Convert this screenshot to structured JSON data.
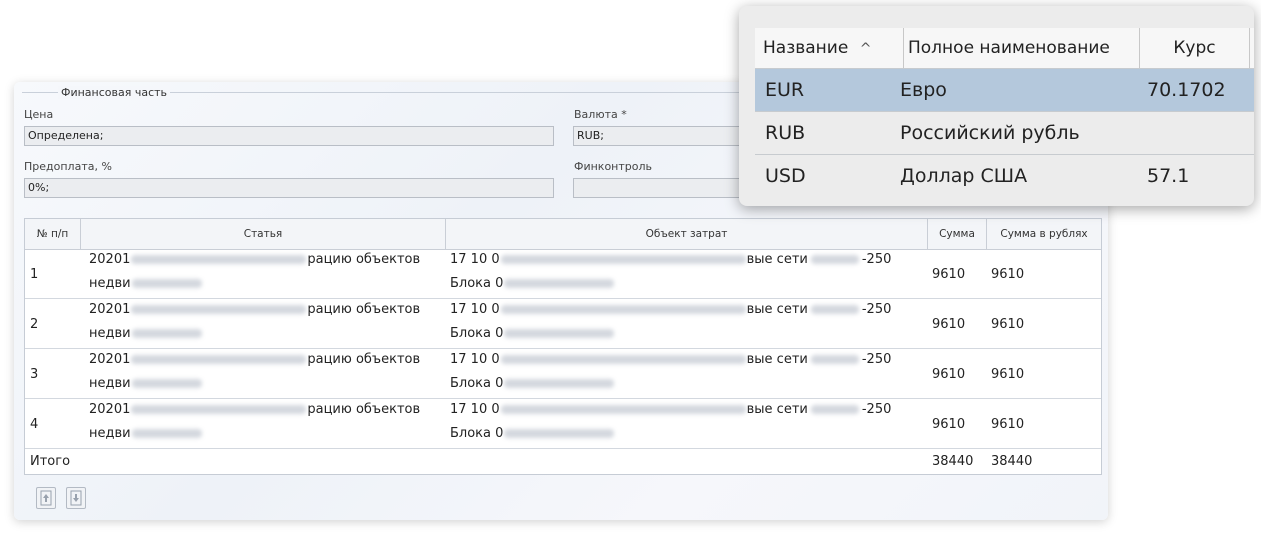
{
  "finance": {
    "section_title": "Финансовая часть",
    "price_label": "Цена",
    "price_value": "Определена;",
    "currency_label": "Валюта *",
    "currency_value": "RUB;",
    "prepay_label": "Предоплата, %",
    "prepay_value": "0%;",
    "fincontrol_label": "Финконтроль",
    "fincontrol_value": ""
  },
  "table": {
    "columns": [
      "№ п/п",
      "Статья",
      "Объект затрат",
      "Сумма",
      "Сумма в рублях"
    ],
    "rows": [
      {
        "num": "1",
        "article_a": "20201",
        "article_b": "рацию объектов",
        "article_c": "недви",
        "object_a": "17 10 0",
        "object_b": "вые сети",
        "object_c": "-250",
        "object_d": "Блока 0",
        "sum": "9610",
        "sum_rub": "9610"
      },
      {
        "num": "2",
        "article_a": "20201",
        "article_b": "рацию объектов",
        "article_c": "недви",
        "object_a": "17 10 0",
        "object_b": "вые сети",
        "object_c": "-250",
        "object_d": "Блока 0",
        "sum": "9610",
        "sum_rub": "9610"
      },
      {
        "num": "3",
        "article_a": "20201",
        "article_b": "рацию объектов",
        "article_c": "недви",
        "object_a": "17 10 0",
        "object_b": "вые сети",
        "object_c": "-250",
        "object_d": "Блока 0",
        "sum": "9610",
        "sum_rub": "9610"
      },
      {
        "num": "4",
        "article_a": "20201",
        "article_b": "рацию объектов",
        "article_c": "недви",
        "object_a": "17 10 0",
        "object_b": "вые сети",
        "object_c": "-250",
        "object_d": "Блока 0",
        "sum": "9610",
        "sum_rub": "9610"
      }
    ],
    "total_label": "Итого",
    "total_sum": "38440",
    "total_sum_rub": "38440"
  },
  "toolbar": {
    "up_icon": "arrow-up-icon",
    "down_icon": "arrow-down-icon"
  },
  "currency_popup": {
    "columns": [
      "Название",
      "Полное наименование",
      "Курс"
    ],
    "sort_indicator": "^",
    "rows": [
      {
        "code": "EUR",
        "name": "Евро",
        "rate": "70.1702",
        "selected": true
      },
      {
        "code": "RUB",
        "name": "Российский рубль",
        "rate": "",
        "selected": false
      },
      {
        "code": "USD",
        "name": "Доллар США",
        "rate": "57.1",
        "selected": false
      }
    ],
    "selected_color": "#b4c8dc"
  }
}
